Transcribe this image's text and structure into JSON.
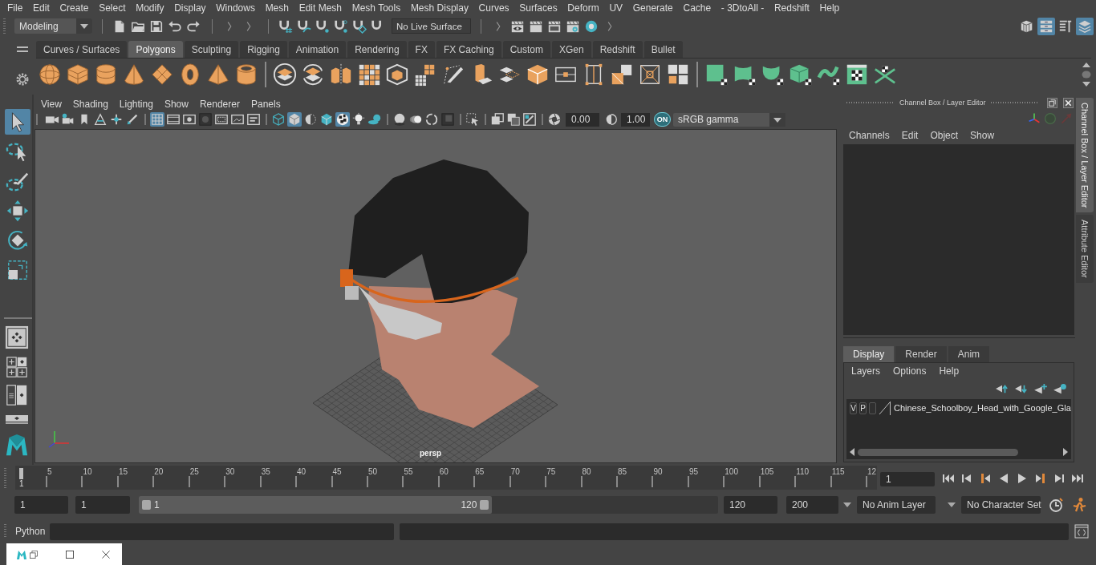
{
  "menu_bar": {
    "items": [
      "File",
      "Edit",
      "Create",
      "Select",
      "Modify",
      "Display",
      "Windows",
      "Mesh",
      "Edit Mesh",
      "Mesh Tools",
      "Mesh Display",
      "Curves",
      "Surfaces",
      "Deform",
      "UV",
      "Generate",
      "Cache",
      "- 3DtoAll -",
      "Redshift",
      "Help"
    ]
  },
  "status_line": {
    "menu_set": "Modeling",
    "live_surface": "No Live Surface",
    "panel_toggles": [
      {
        "selected": false
      },
      {
        "selected": true
      },
      {
        "selected": false
      },
      {
        "selected": true
      }
    ]
  },
  "shelf": {
    "tabs": [
      {
        "label": "Curves / Surfaces",
        "selected": false
      },
      {
        "label": "Polygons",
        "selected": true
      },
      {
        "label": "Sculpting",
        "selected": false
      },
      {
        "label": "Rigging",
        "selected": false
      },
      {
        "label": "Animation",
        "selected": false
      },
      {
        "label": "Rendering",
        "selected": false
      },
      {
        "label": "FX",
        "selected": false
      },
      {
        "label": "FX Caching",
        "selected": false
      },
      {
        "label": "Custom",
        "selected": false
      },
      {
        "label": "XGen",
        "selected": false
      },
      {
        "label": "Redshift",
        "selected": false
      },
      {
        "label": "Bullet",
        "selected": false
      }
    ]
  },
  "toolbox": {
    "tools": [
      {
        "selected": true
      },
      {
        "selected": false
      },
      {
        "selected": false
      },
      {
        "selected": false
      },
      {
        "selected": false
      },
      {
        "selected": false
      }
    ]
  },
  "viewport": {
    "menus": [
      "View",
      "Shading",
      "Lighting",
      "Show",
      "Renderer",
      "Panels"
    ],
    "toolbar": [
      {
        "on": false
      },
      {
        "on": false
      },
      {
        "on": false
      },
      {
        "on": false
      },
      {
        "on": false
      },
      {
        "on": false
      },
      {
        "on": true
      },
      {
        "on": false
      },
      {
        "on": false
      },
      {
        "on": false
      },
      {
        "on": false
      },
      {
        "on": false
      },
      {
        "on": false
      },
      {
        "on": false
      },
      {
        "on": true
      },
      {
        "on": false
      },
      {
        "on": false
      },
      {
        "on": true
      },
      {
        "on": false
      },
      {
        "on": false
      },
      {
        "on": false
      },
      {
        "on": false
      },
      {
        "on": false
      },
      {
        "on": false
      },
      {
        "on": false
      },
      {
        "on": false
      },
      {
        "on": false
      },
      {
        "on": false
      }
    ],
    "exposure": "0.00",
    "gamma": "1.00",
    "color_management": "ON",
    "color_space": "sRGB gamma",
    "camera": "persp"
  },
  "channel_box": {
    "title": "Channel Box / Layer Editor",
    "menus": [
      "Channels",
      "Edit",
      "Object",
      "Show"
    ],
    "layer_tabs": [
      {
        "label": "Display",
        "selected": true
      },
      {
        "label": "Render",
        "selected": false
      },
      {
        "label": "Anim",
        "selected": false
      }
    ],
    "layer_menus": [
      "Layers",
      "Options",
      "Help"
    ],
    "layers": [
      {
        "visible": "V",
        "playback": "P",
        "name": "Chinese_Schoolboy_Head_with_Google_Gla"
      }
    ]
  },
  "side_tabs": [
    {
      "label": "Channel Box / Layer Editor",
      "selected": true
    },
    {
      "label": "Attribute Editor",
      "selected": false
    }
  ],
  "time_slider": {
    "playhead": "1",
    "level": 0,
    "ticks": [
      "5",
      "10",
      "15",
      "20",
      "25",
      "30",
      "35",
      "40",
      "45",
      "50",
      "55",
      "60",
      "65",
      "70",
      "75",
      "80",
      "85",
      "90",
      "95",
      "100",
      "105",
      "110",
      "115",
      "12"
    ],
    "current_frame": "1"
  },
  "range_slider": {
    "start": "1",
    "playback_start": "1",
    "range_start": "1",
    "range_end": "120",
    "level": 0.61,
    "playback_end": "120",
    "end": "200",
    "anim_layer": "No Anim Layer",
    "character_set": "No Character Set"
  },
  "command_line": {
    "language": "Python"
  }
}
